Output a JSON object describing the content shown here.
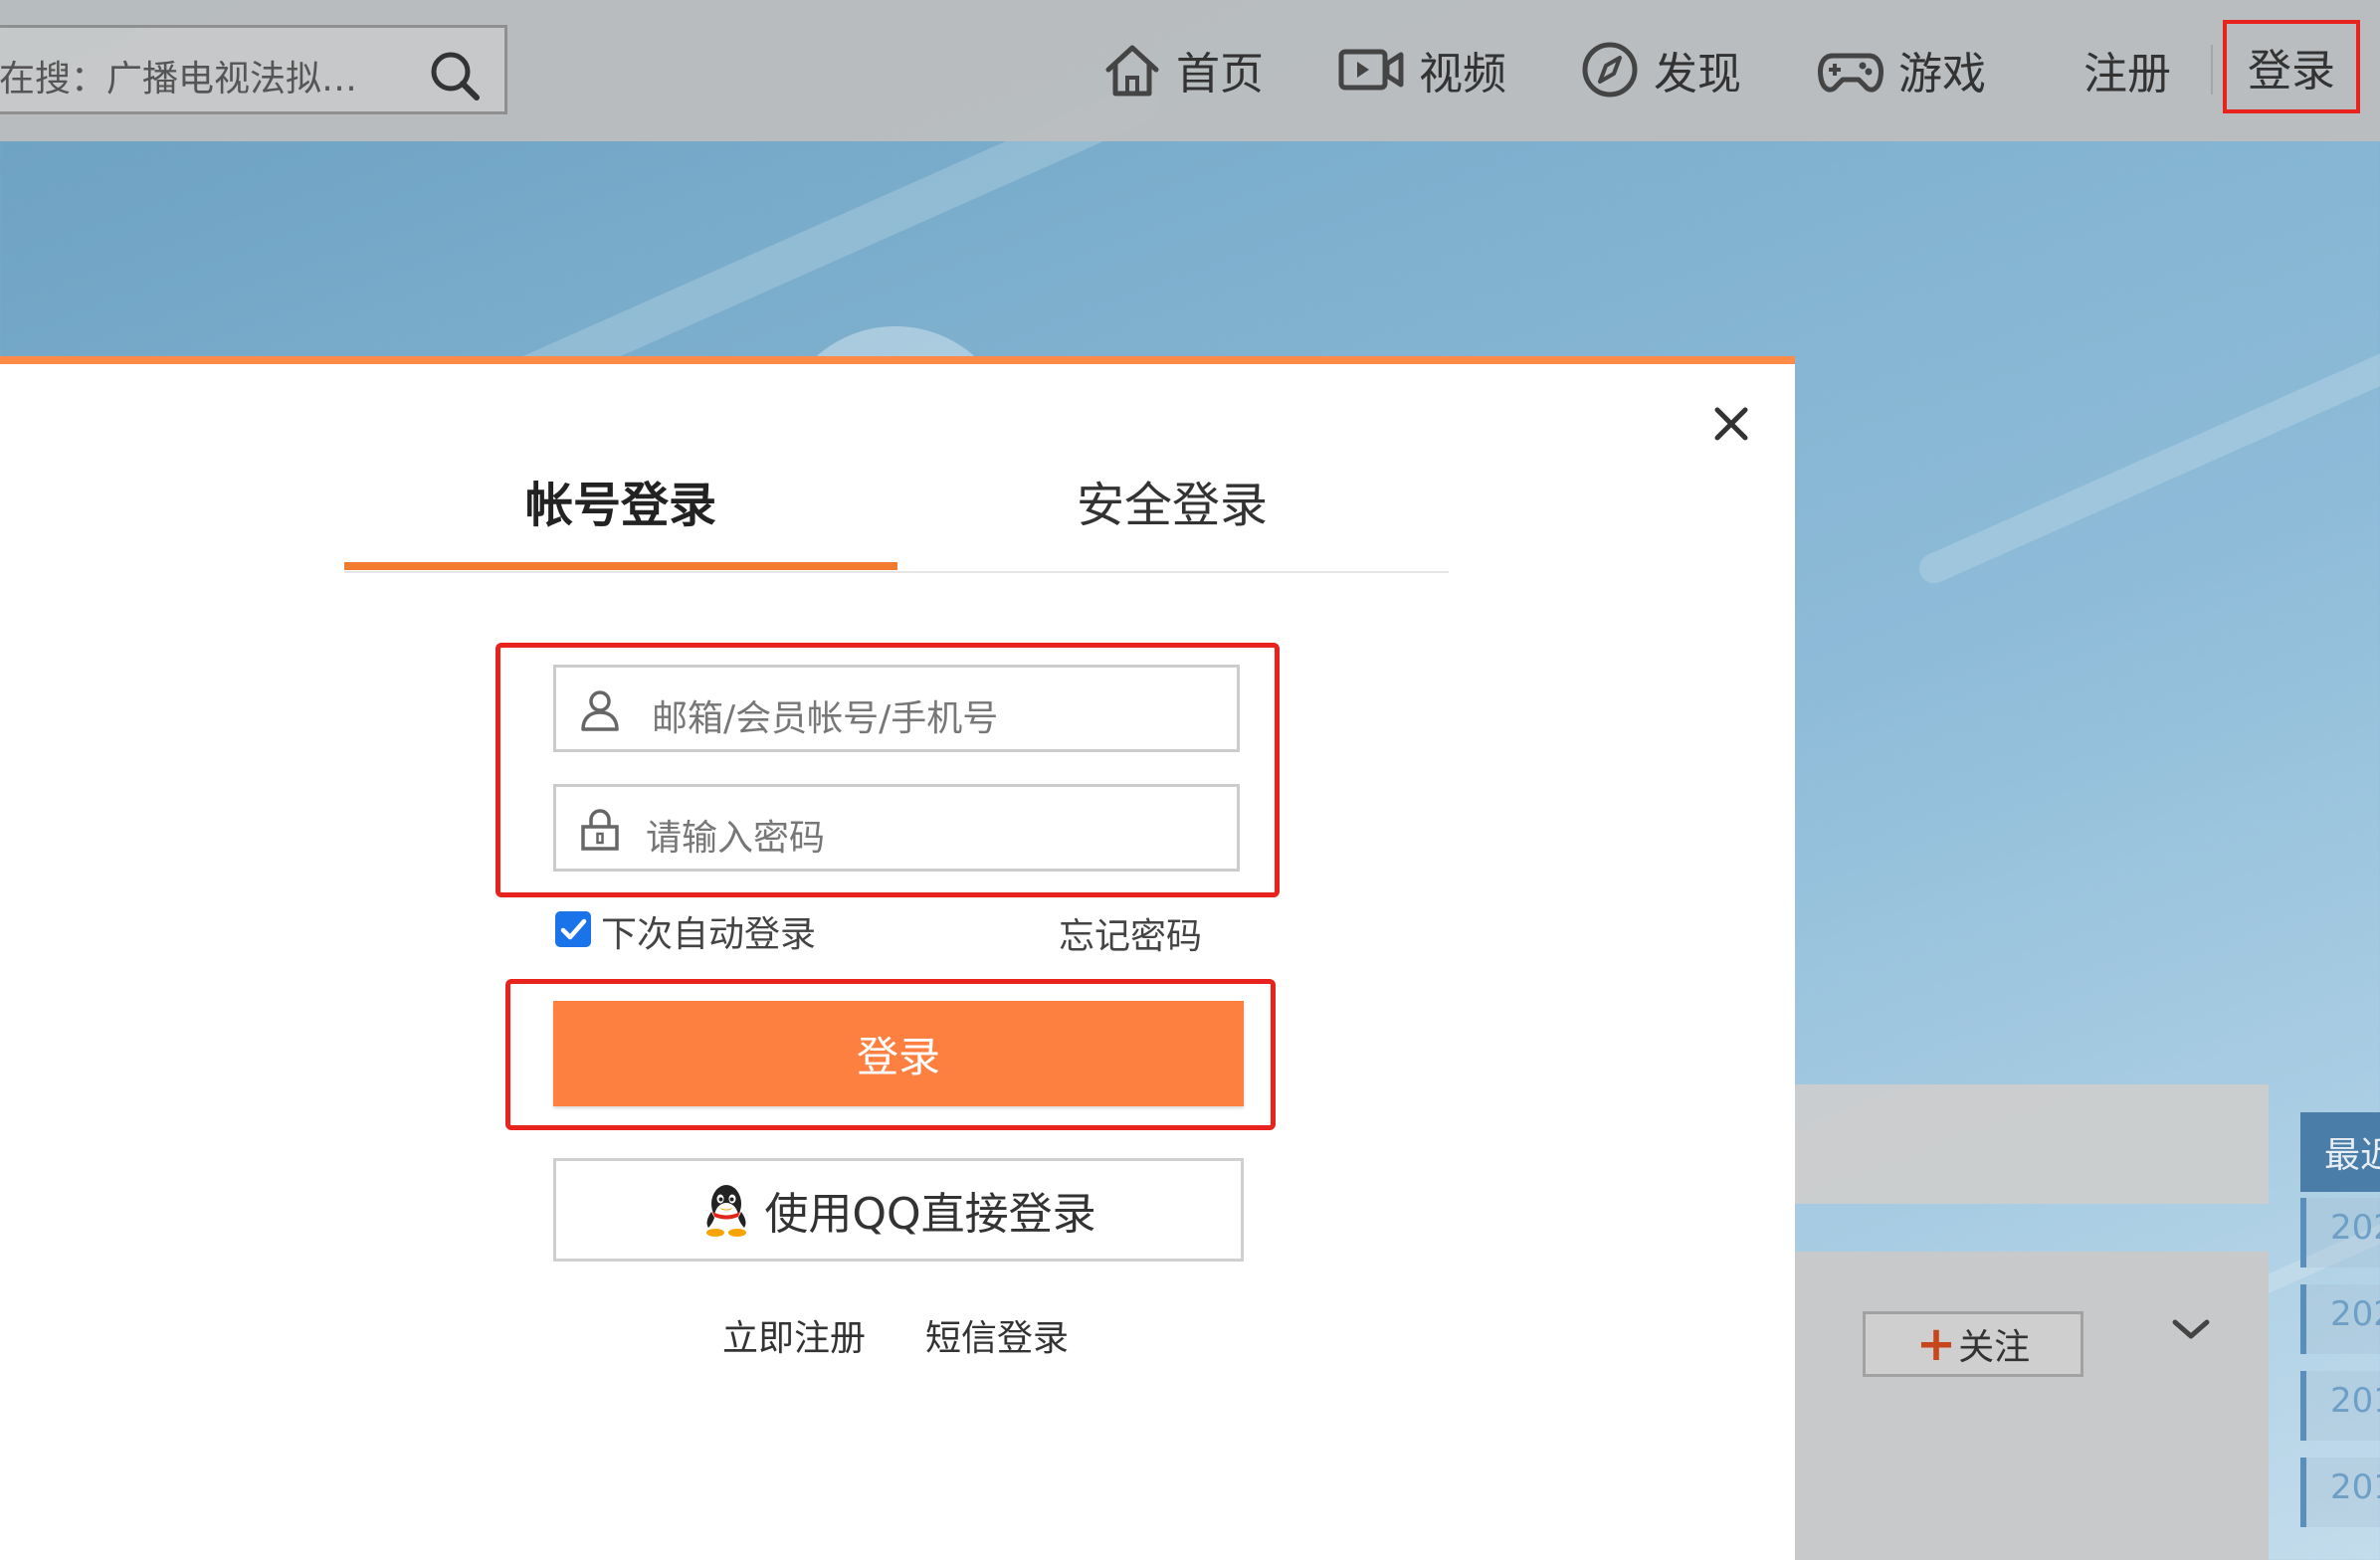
{
  "search": {
    "text": "在搜：广播电视法拟规…"
  },
  "nav": {
    "items": [
      {
        "label": "首页",
        "icon": "home-icon"
      },
      {
        "label": "视频",
        "icon": "video-icon"
      },
      {
        "label": "发现",
        "icon": "compass-icon"
      },
      {
        "label": "游戏",
        "icon": "gamepad-icon"
      }
    ],
    "register_label": "注册",
    "login_label": "登录"
  },
  "login_modal": {
    "tabs": [
      {
        "label": "帐号登录",
        "active": true
      },
      {
        "label": "安全登录",
        "active": false
      }
    ],
    "username_placeholder": "邮箱/会员帐号/手机号",
    "password_placeholder": "请输入密码",
    "auto_login_label": "下次自动登录",
    "auto_login_checked": true,
    "forgot_password_label": "忘记密码",
    "submit_label": "登录",
    "qq_login_label": "使用QQ直接登录",
    "register_link": "立即注册",
    "sms_login_link": "短信登录"
  },
  "background": {
    "follow_label": "关注",
    "recent_label": "最近",
    "years": [
      "202",
      "202",
      "201",
      "201"
    ]
  },
  "colors": {
    "accent": "#fe8040",
    "highlight": "#e8231e",
    "checkbox": "#1a73e8"
  }
}
